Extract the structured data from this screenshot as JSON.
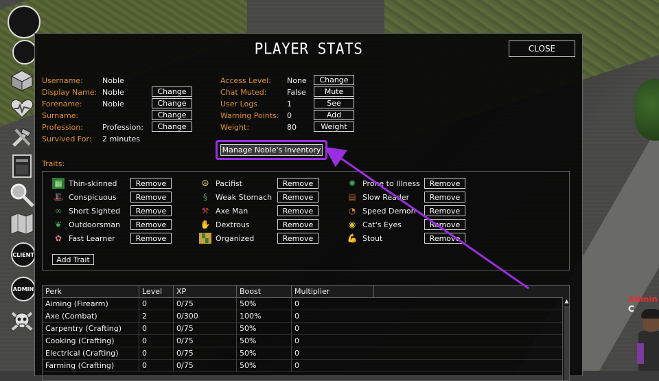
{
  "world": {
    "npc_name_admin": "Admin",
    "npc_name_rest": "C"
  },
  "sidebar": {
    "items": [
      {
        "name": "health-icon"
      },
      {
        "name": "crafting-icon"
      },
      {
        "name": "map-icon"
      },
      {
        "name": "search-icon"
      },
      {
        "name": "client-icon",
        "label": "CLIENT"
      },
      {
        "name": "admin-icon",
        "label": "ADMIN"
      },
      {
        "name": "skull-icon"
      }
    ]
  },
  "panel": {
    "title": "PLAYER STATS",
    "close_label": "CLOSE",
    "left_fields": [
      {
        "label": "Username:",
        "value": "Noble",
        "button": ""
      },
      {
        "label": "Display Name:",
        "value": "Noble",
        "button": "Change"
      },
      {
        "label": "Forename:",
        "value": "Noble",
        "button": "Change"
      },
      {
        "label": "Surname:",
        "value": "",
        "button": "Change"
      },
      {
        "label": "Profession:",
        "value": "Profession:",
        "button": "Change"
      },
      {
        "label": "Survived For:",
        "value": "2 minutes",
        "button": ""
      }
    ],
    "right_fields": [
      {
        "label": "Access Level:",
        "value": "None",
        "button": "Change"
      },
      {
        "label": "Chat Muted:",
        "value": "False",
        "button": "Mute"
      },
      {
        "label": "User Logs",
        "value": "1",
        "button": "See"
      },
      {
        "label": "Warning Points:",
        "value": "0",
        "button": "Add"
      },
      {
        "label": "Weight:",
        "value": "80",
        "button": "Weight"
      }
    ],
    "manage_inventory_label": "Manage Noble's Inventory",
    "traits_label": "Traits:",
    "remove_label": "Remove",
    "add_trait_label": "Add Trait",
    "traits": [
      [
        {
          "name": "Thin-skinned",
          "icon": "thin-skinned-icon",
          "color": "#2e8b3a"
        },
        {
          "name": "Conspicuous",
          "icon": "hat-icon",
          "color": "#b5651d"
        },
        {
          "name": "Short Sighted",
          "icon": "glasses-icon",
          "color": "#3aa050"
        },
        {
          "name": "Outdoorsman",
          "icon": "leaf-icon",
          "color": "#4caf50"
        },
        {
          "name": "Fast Learner",
          "icon": "brain-icon",
          "color": "#e07a8a"
        }
      ],
      [
        {
          "name": "Pacifist",
          "icon": "peace-icon",
          "color": "#f0d070"
        },
        {
          "name": "Weak Stomach",
          "icon": "stomach-icon",
          "color": "#4aa860"
        },
        {
          "name": "Axe Man",
          "icon": "axe-icon",
          "color": "#c0392b"
        },
        {
          "name": "Dextrous",
          "icon": "hands-icon",
          "color": "#4caf50"
        },
        {
          "name": "Organized",
          "icon": "organized-icon",
          "color": "#c8a040"
        }
      ],
      [
        {
          "name": "Prone to Illness",
          "icon": "illness-icon",
          "color": "#3cae5a"
        },
        {
          "name": "Slow Reader",
          "icon": "book-icon",
          "color": "#b5651d"
        },
        {
          "name": "Speed Demon",
          "icon": "speedometer-icon",
          "color": "#d08a30"
        },
        {
          "name": "Cat's Eyes",
          "icon": "eyes-icon",
          "color": "#e0c030"
        },
        {
          "name": "Stout",
          "icon": "muscle-icon",
          "color": "#d07060"
        }
      ]
    ],
    "perk_table": {
      "columns": [
        "Perk",
        "Level",
        "XP",
        "Boost",
        "Multiplier"
      ],
      "rows": [
        [
          "Aiming (Firearm)",
          "0",
          "0/75",
          "50%",
          "0"
        ],
        [
          "Axe (Combat)",
          "2",
          "0/300",
          "100%",
          "0"
        ],
        [
          "Carpentry (Crafting)",
          "0",
          "0/75",
          "50%",
          "0"
        ],
        [
          "Cooking (Crafting)",
          "0",
          "0/75",
          "50%",
          "0"
        ],
        [
          "Electrical (Crafting)",
          "0",
          "0/75",
          "50%",
          "0"
        ],
        [
          "Farming (Crafting)",
          "0",
          "0/75",
          "50%",
          "0"
        ]
      ]
    }
  },
  "annotation_color": "#9a2ee0"
}
